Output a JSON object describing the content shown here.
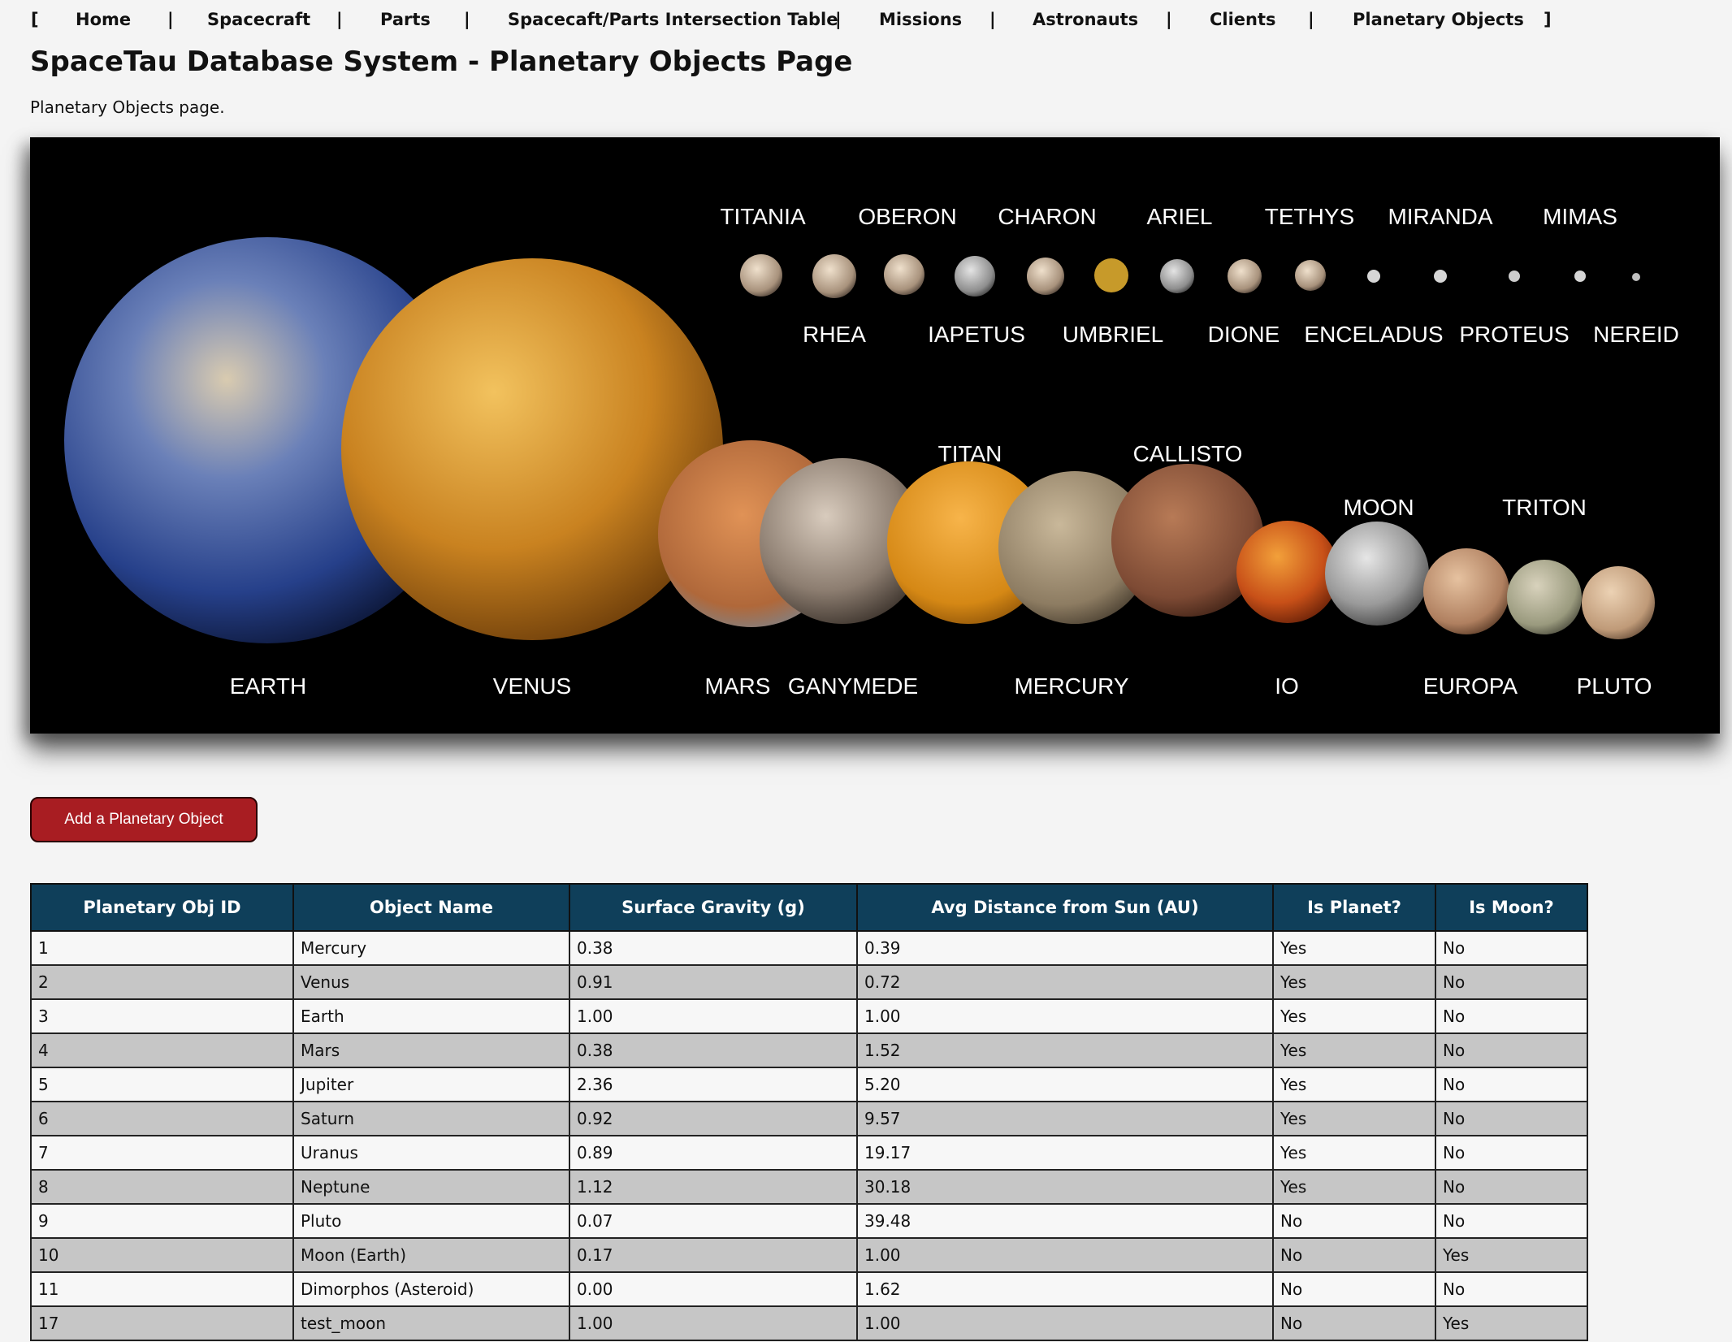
{
  "nav": {
    "open_bracket": "[",
    "close_bracket": "]",
    "separator": "|",
    "items": [
      "Home",
      "Spacecraft",
      "Parts",
      "Spacecaft/Parts Intersection Table",
      "Missions",
      "Astronauts",
      "Clients",
      "Planetary Objects"
    ]
  },
  "page": {
    "title": "SpaceTau Database System - Planetary Objects Page",
    "subtitle": "Planetary Objects page."
  },
  "banner": {
    "labels": [
      "TITANIA",
      "OBERON",
      "CHARON",
      "ARIEL",
      "TETHYS",
      "MIRANDA",
      "MIMAS",
      "RHEA",
      "IAPETUS",
      "UMBRIEL",
      "DIONE",
      "ENCELADUS",
      "PROTEUS",
      "NEREID",
      "TITAN",
      "CALLISTO",
      "MOON",
      "TRITON",
      "EARTH",
      "VENUS",
      "MARS",
      "GANYMEDE",
      "MERCURY",
      "IO",
      "EUROPA",
      "PLUTO"
    ]
  },
  "add_button": {
    "label": "Add a Planetary Object"
  },
  "table": {
    "headers": [
      "Planetary Obj ID",
      "Object Name",
      "Surface Gravity (g)",
      "Avg Distance from Sun (AU)",
      "Is Planet?",
      "Is Moon?"
    ],
    "rows": [
      [
        "1",
        "Mercury",
        "0.38",
        "0.39",
        "Yes",
        "No"
      ],
      [
        "2",
        "Venus",
        "0.91",
        "0.72",
        "Yes",
        "No"
      ],
      [
        "3",
        "Earth",
        "1.00",
        "1.00",
        "Yes",
        "No"
      ],
      [
        "4",
        "Mars",
        "0.38",
        "1.52",
        "Yes",
        "No"
      ],
      [
        "5",
        "Jupiter",
        "2.36",
        "5.20",
        "Yes",
        "No"
      ],
      [
        "6",
        "Saturn",
        "0.92",
        "9.57",
        "Yes",
        "No"
      ],
      [
        "7",
        "Uranus",
        "0.89",
        "19.17",
        "Yes",
        "No"
      ],
      [
        "8",
        "Neptune",
        "1.12",
        "30.18",
        "Yes",
        "No"
      ],
      [
        "9",
        "Pluto",
        "0.07",
        "39.48",
        "No",
        "No"
      ],
      [
        "10",
        "Moon (Earth)",
        "0.17",
        "1.00",
        "No",
        "Yes"
      ],
      [
        "11",
        "Dimorphos (Asteroid)",
        "0.00",
        "1.62",
        "No",
        "No"
      ],
      [
        "17",
        "test_moon",
        "1.00",
        "1.00",
        "No",
        "Yes"
      ]
    ]
  },
  "colors": {
    "header_bg": "#0f3f5a",
    "button_bg": "#a81d22",
    "row_alt": "#c6c6c6"
  }
}
